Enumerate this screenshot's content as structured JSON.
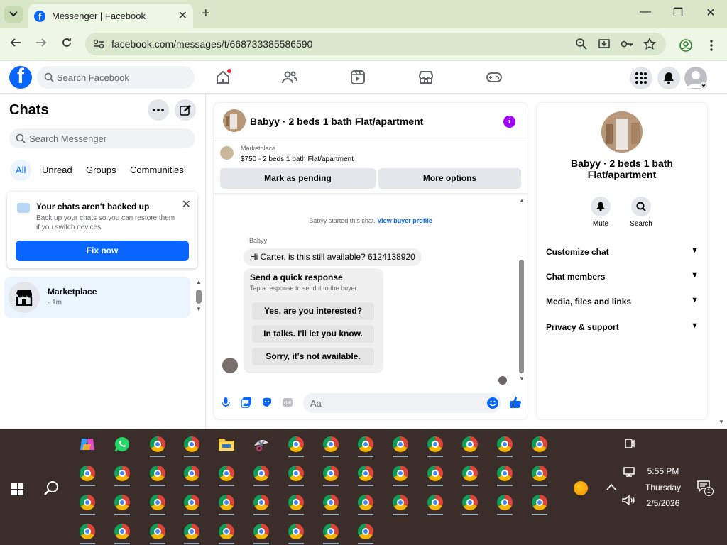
{
  "browser": {
    "tab_title": "Messenger | Facebook",
    "tab_close": "✕",
    "new_tab": "+",
    "url": "facebook.com/messages/t/668733385586590",
    "window_controls": [
      "—",
      "❐",
      "✕"
    ]
  },
  "fb_nav": {
    "logo_letter": "f",
    "search_placeholder": "Search Facebook",
    "icons": [
      "home-icon",
      "friends-icon",
      "video-icon",
      "marketplace-icon",
      "gaming-icon"
    ],
    "right_icons": [
      "menu-grid-icon",
      "notifications-icon",
      "account-icon"
    ]
  },
  "left_panel": {
    "title": "Chats",
    "search_placeholder": "Search Messenger",
    "filters": [
      "All",
      "Unread",
      "Groups",
      "Communities"
    ],
    "active_filter": "All",
    "backup_card": {
      "title": "Your chats aren't backed up",
      "description": "Back up your chats so you can restore them if you switch devices.",
      "button": "Fix now",
      "close": "✕"
    },
    "conversations": [
      {
        "name": "Marketplace",
        "time": "· 1m"
      }
    ]
  },
  "conversation": {
    "title": "Babyy · 2 beds 1 bath Flat/apartment",
    "info_letter": "i",
    "marketplace_label": "Marketplace",
    "listing": "$750 - 2 beds 1 bath Flat/apartment",
    "actions": [
      "Mark as pending",
      "More options"
    ],
    "started_text": "Babyy started this chat.",
    "view_profile": "View buyer profile",
    "sender": "Babyy",
    "message": "Hi Carter, is this still available? 6124138920",
    "quick_response": {
      "title": "Send a quick response",
      "subtitle": "Tap a response to send it to the buyer.",
      "options": [
        "Yes, are you interested?",
        "In talks. I'll let you know.",
        "Sorry, it's not available."
      ]
    },
    "composer_placeholder": "Aa"
  },
  "info_panel": {
    "title": "Babyy · 2 beds 1 bath Flat/apartment",
    "actions": [
      {
        "label": "Mute",
        "icon": "bell-icon"
      },
      {
        "label": "Search",
        "icon": "search-icon"
      }
    ],
    "sections": [
      "Customize chat",
      "Chat members",
      "Media, files and links",
      "Privacy & support"
    ]
  },
  "taskbar": {
    "time": "5:55 PM",
    "day": "Thursday",
    "date": "2/5/2026",
    "notification_count": "1"
  },
  "colors": {
    "accent": "#0866ff",
    "tabbar": "#d7e7c8",
    "taskbar": "#3b2e2a",
    "info_purple": "#a100ff"
  }
}
